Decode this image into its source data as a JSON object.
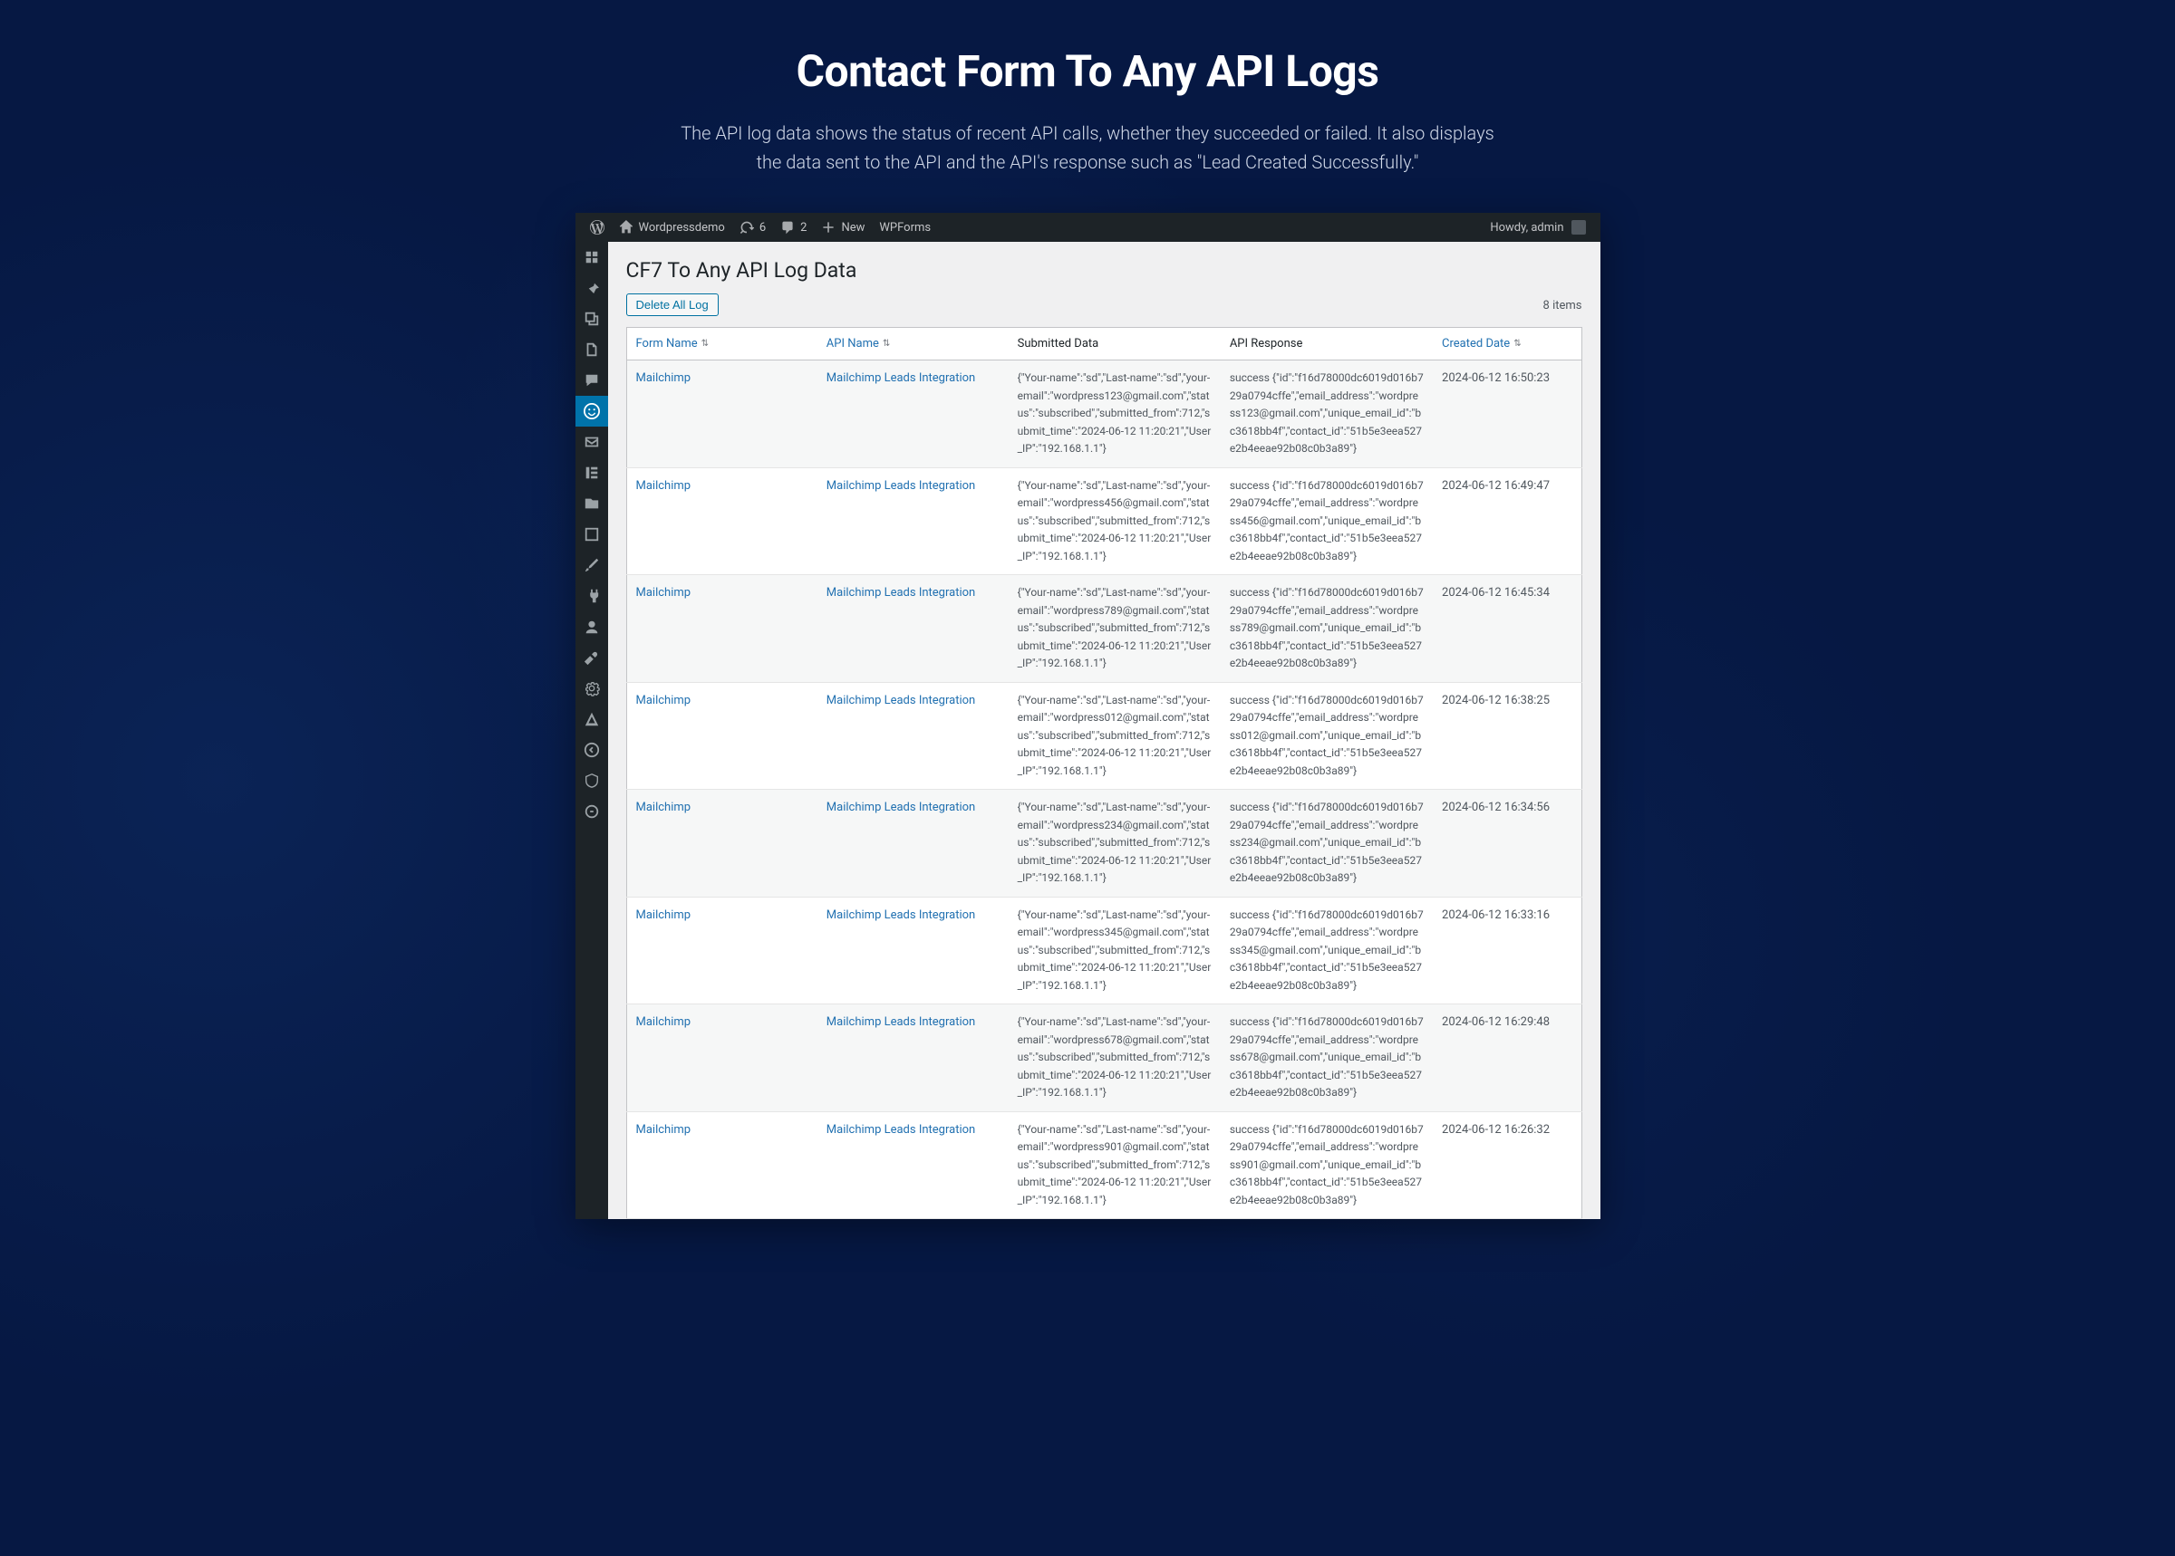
{
  "hero": {
    "title": "Contact Form To Any API Logs",
    "subtitle": "The API log data shows the status of recent API calls, whether they succeeded or failed. It also displays the data sent to the API and the API's response such as \"Lead Created Successfully.\""
  },
  "adminbar": {
    "site_name": "Wordpressdemo",
    "updates_count": "6",
    "comments_count": "2",
    "new_label": "New",
    "wpforms_label": "WPForms",
    "howdy": "Howdy, admin"
  },
  "page": {
    "title": "CF7 To Any API Log Data",
    "delete_label": "Delete All Log",
    "items_label": "8 items"
  },
  "columns": {
    "form_name": "Form Name",
    "api_name": "API Name",
    "submitted_data": "Submitted Data",
    "api_response": "API Response",
    "created_date": "Created Date"
  },
  "rows": [
    {
      "form_name": "Mailchimp",
      "api_name": "Mailchimp Leads Integration",
      "submitted_data": "{\"Your-name\":\"sd\",\"Last-name\":\"sd\",\"your-email\":\"wordpress123@gmail.com\",\"status\":\"subscribed\",\"submitted_from\":712,\"submit_time\":\"2024-06-12 11:20:21\",\"User_IP\":\"192.168.1.1\"}",
      "api_response": "success {\"id\":\"f16d78000dc6019d016b729a0794cffe\",\"email_address\":\"wordpress123@gmail.com\",\"unique_email_id\":\"bc3618bb4f\",\"contact_id\":\"51b5e3eea527e2b4eeae92b08c0b3a89\"}",
      "created_date": "2024-06-12 16:50:23"
    },
    {
      "form_name": "Mailchimp",
      "api_name": "Mailchimp Leads Integration",
      "submitted_data": "{\"Your-name\":\"sd\",\"Last-name\":\"sd\",\"your-email\":\"wordpress456@gmail.com\",\"status\":\"subscribed\",\"submitted_from\":712,\"submit_time\":\"2024-06-12 11:20:21\",\"User_IP\":\"192.168.1.1\"}",
      "api_response": "success {\"id\":\"f16d78000dc6019d016b729a0794cffe\",\"email_address\":\"wordpress456@gmail.com\",\"unique_email_id\":\"bc3618bb4f\",\"contact_id\":\"51b5e3eea527e2b4eeae92b08c0b3a89\"}",
      "created_date": "2024-06-12 16:49:47"
    },
    {
      "form_name": "Mailchimp",
      "api_name": "Mailchimp Leads Integration",
      "submitted_data": "{\"Your-name\":\"sd\",\"Last-name\":\"sd\",\"your-email\":\"wordpress789@gmail.com\",\"status\":\"subscribed\",\"submitted_from\":712,\"submit_time\":\"2024-06-12 11:20:21\",\"User_IP\":\"192.168.1.1\"}",
      "api_response": "success {\"id\":\"f16d78000dc6019d016b729a0794cffe\",\"email_address\":\"wordpress789@gmail.com\",\"unique_email_id\":\"bc3618bb4f\",\"contact_id\":\"51b5e3eea527e2b4eeae92b08c0b3a89\"}",
      "created_date": "2024-06-12 16:45:34"
    },
    {
      "form_name": "Mailchimp",
      "api_name": "Mailchimp Leads Integration",
      "submitted_data": "{\"Your-name\":\"sd\",\"Last-name\":\"sd\",\"your-email\":\"wordpress012@gmail.com\",\"status\":\"subscribed\",\"submitted_from\":712,\"submit_time\":\"2024-06-12 11:20:21\",\"User_IP\":\"192.168.1.1\"}",
      "api_response": "success {\"id\":\"f16d78000dc6019d016b729a0794cffe\",\"email_address\":\"wordpress012@gmail.com\",\"unique_email_id\":\"bc3618bb4f\",\"contact_id\":\"51b5e3eea527e2b4eeae92b08c0b3a89\"}",
      "created_date": "2024-06-12 16:38:25"
    },
    {
      "form_name": "Mailchimp",
      "api_name": "Mailchimp Leads Integration",
      "submitted_data": "{\"Your-name\":\"sd\",\"Last-name\":\"sd\",\"your-email\":\"wordpress234@gmail.com\",\"status\":\"subscribed\",\"submitted_from\":712,\"submit_time\":\"2024-06-12 11:20:21\",\"User_IP\":\"192.168.1.1\"}",
      "api_response": "success {\"id\":\"f16d78000dc6019d016b729a0794cffe\",\"email_address\":\"wordpress234@gmail.com\",\"unique_email_id\":\"bc3618bb4f\",\"contact_id\":\"51b5e3eea527e2b4eeae92b08c0b3a89\"}",
      "created_date": "2024-06-12 16:34:56"
    },
    {
      "form_name": "Mailchimp",
      "api_name": "Mailchimp Leads Integration",
      "submitted_data": "{\"Your-name\":\"sd\",\"Last-name\":\"sd\",\"your-email\":\"wordpress345@gmail.com\",\"status\":\"subscribed\",\"submitted_from\":712,\"submit_time\":\"2024-06-12 11:20:21\",\"User_IP\":\"192.168.1.1\"}",
      "api_response": "success {\"id\":\"f16d78000dc6019d016b729a0794cffe\",\"email_address\":\"wordpress345@gmail.com\",\"unique_email_id\":\"bc3618bb4f\",\"contact_id\":\"51b5e3eea527e2b4eeae92b08c0b3a89\"}",
      "created_date": "2024-06-12 16:33:16"
    },
    {
      "form_name": "Mailchimp",
      "api_name": "Mailchimp Leads Integration",
      "submitted_data": "{\"Your-name\":\"sd\",\"Last-name\":\"sd\",\"your-email\":\"wordpress678@gmail.com\",\"status\":\"subscribed\",\"submitted_from\":712,\"submit_time\":\"2024-06-12 11:20:21\",\"User_IP\":\"192.168.1.1\"}",
      "api_response": "success {\"id\":\"f16d78000dc6019d016b729a0794cffe\",\"email_address\":\"wordpress678@gmail.com\",\"unique_email_id\":\"bc3618bb4f\",\"contact_id\":\"51b5e3eea527e2b4eeae92b08c0b3a89\"}",
      "created_date": "2024-06-12 16:29:48"
    },
    {
      "form_name": "Mailchimp",
      "api_name": "Mailchimp Leads Integration",
      "submitted_data": "{\"Your-name\":\"sd\",\"Last-name\":\"sd\",\"your-email\":\"wordpress901@gmail.com\",\"status\":\"subscribed\",\"submitted_from\":712,\"submit_time\":\"2024-06-12 11:20:21\",\"User_IP\":\"192.168.1.1\"}",
      "api_response": "success {\"id\":\"f16d78000dc6019d016b729a0794cffe\",\"email_address\":\"wordpress901@gmail.com\",\"unique_email_id\":\"bc3618bb4f\",\"contact_id\":\"51b5e3eea527e2b4eeae92b08c0b3a89\"}",
      "created_date": "2024-06-12 16:26:32"
    }
  ]
}
